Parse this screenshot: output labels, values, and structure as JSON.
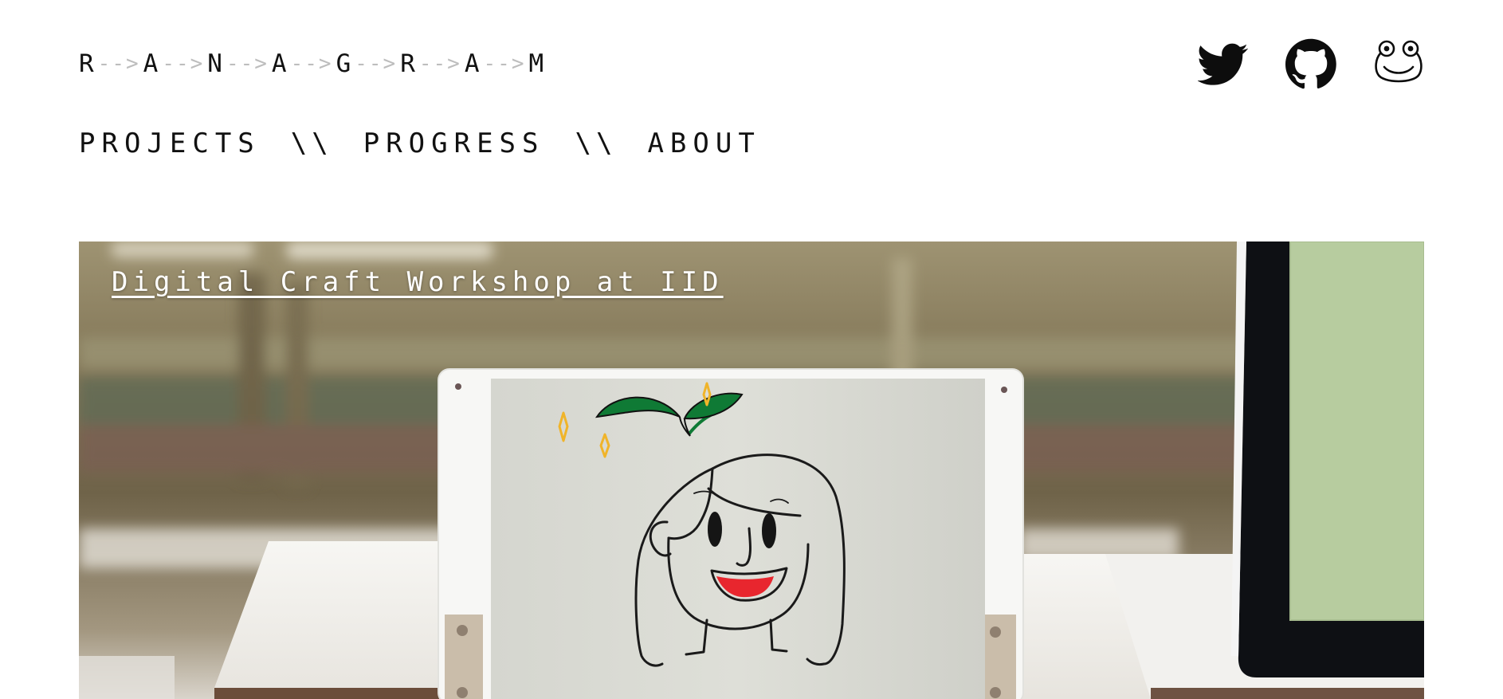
{
  "logo": {
    "letters": [
      "R",
      "A",
      "N",
      "A",
      "G",
      "R",
      "A",
      "M"
    ],
    "arrow": "-->"
  },
  "social": [
    {
      "name": "twitter",
      "icon": "twitter-bird-icon"
    },
    {
      "name": "github",
      "icon": "github-octocat-icon"
    },
    {
      "name": "frog",
      "icon": "frog-face-icon"
    }
  ],
  "nav": {
    "items": [
      "PROJECTS",
      "PROGRESS",
      "ABOUT"
    ],
    "separator": "\\\\"
  },
  "hero": {
    "title": "Digital Craft Workshop at IID",
    "image": "photo-of-hand-drawn-girl-with-sprout-on-display-frame"
  },
  "colors": {
    "text": "#111111",
    "arrow": "#bdbdbd",
    "sprout": "#0f7a35",
    "sparkle": "#f0b429",
    "tongue": "#e8262e"
  }
}
